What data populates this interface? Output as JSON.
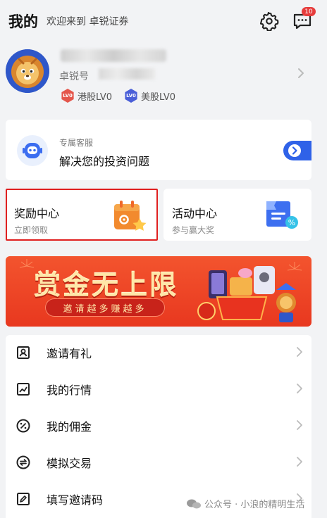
{
  "header": {
    "title": "我的",
    "welcome": "欢迎来到 卓锐证券",
    "message_badge": "10",
    "icons": {
      "settings": "gear-icon",
      "messages": "message-icon"
    }
  },
  "profile": {
    "uid_label": "卓锐号",
    "hk_level": "港股LV0",
    "us_level": "美股LV0",
    "level_badge_text": "LV0"
  },
  "service": {
    "subtitle": "专属客服",
    "title": "解决您的投资问题"
  },
  "cards": {
    "reward": {
      "title": "奖励中心",
      "subtitle": "立即领取"
    },
    "activity": {
      "title": "活动中心",
      "subtitle": "参与赢大奖"
    }
  },
  "banner": {
    "headline": "赏金无上限",
    "tagline": "邀请越多赚越多"
  },
  "menu": [
    {
      "label": "邀请有礼",
      "icon": "portrait-icon"
    },
    {
      "label": "我的行情",
      "icon": "chart-icon"
    },
    {
      "label": "我的佣金",
      "icon": "percent-icon"
    },
    {
      "label": "模拟交易",
      "icon": "exchange-icon"
    },
    {
      "label": "填写邀请码",
      "icon": "edit-icon"
    }
  ],
  "watermark": "公众号 · 小浪的精明生活",
  "colors": {
    "accent": "#2f62e8",
    "badge": "#e63c3c",
    "banner": "#e8381f",
    "highlight_border": "#e02020"
  }
}
